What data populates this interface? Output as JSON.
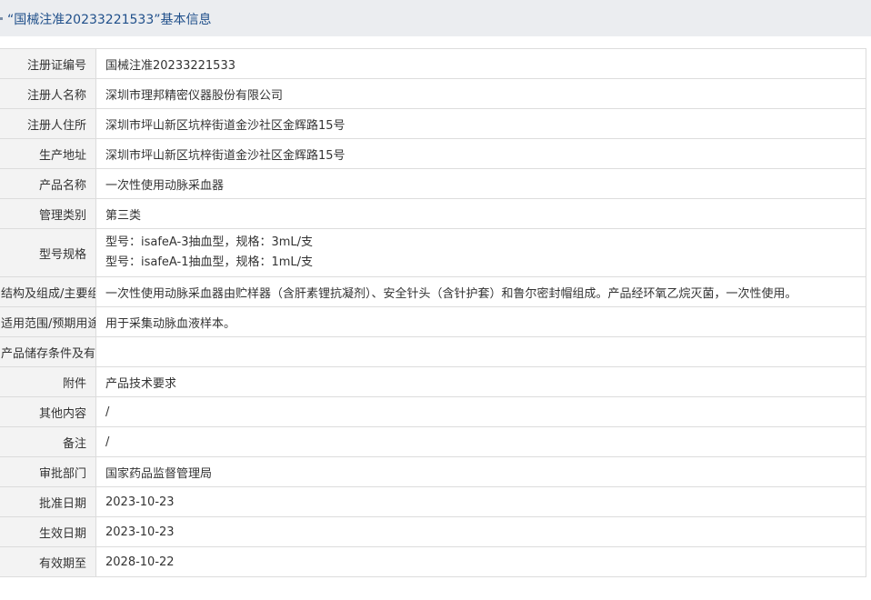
{
  "header": {
    "title": "“国械注准20233221533”基本信息"
  },
  "rows": [
    {
      "label": "注册证编号",
      "value": "国械注准20233221533"
    },
    {
      "label": "注册人名称",
      "value": "深圳市理邦精密仪器股份有限公司"
    },
    {
      "label": "注册人住所",
      "value": "深圳市坪山新区坑梓街道金沙社区金辉路15号"
    },
    {
      "label": "生产地址",
      "value": "深圳市坪山新区坑梓街道金沙社区金辉路15号"
    },
    {
      "label": "产品名称",
      "value": "一次性使用动脉采血器"
    },
    {
      "label": "管理类别",
      "value": "第三类"
    },
    {
      "label": "型号规格",
      "value_lines": [
        "型号：isafeA-3抽血型，规格：3mL/支",
        "型号：isafeA-1抽血型，规格：1mL/支"
      ]
    },
    {
      "label": "结构及组成/主要组成成分",
      "value": "一次性使用动脉采血器由贮样器（含肝素锂抗凝剂）、安全针头（含针护套）和鲁尔密封帽组成。产品经环氧乙烷灭菌，一次性使用。"
    },
    {
      "label": "适用范围/预期用途",
      "value": "用于采集动脉血液样本。"
    },
    {
      "label": "产品储存条件及有效期",
      "value": ""
    },
    {
      "label": "附件",
      "value": "产品技术要求"
    },
    {
      "label": "其他内容",
      "value": "/"
    },
    {
      "label": "备注",
      "value": "/"
    },
    {
      "label": "审批部门",
      "value": "国家药品监督管理局"
    },
    {
      "label": "批准日期",
      "value": "2023-10-23"
    },
    {
      "label": "生效日期",
      "value": "2023-10-23"
    },
    {
      "label": "有效期至",
      "value": "2028-10-22"
    }
  ]
}
